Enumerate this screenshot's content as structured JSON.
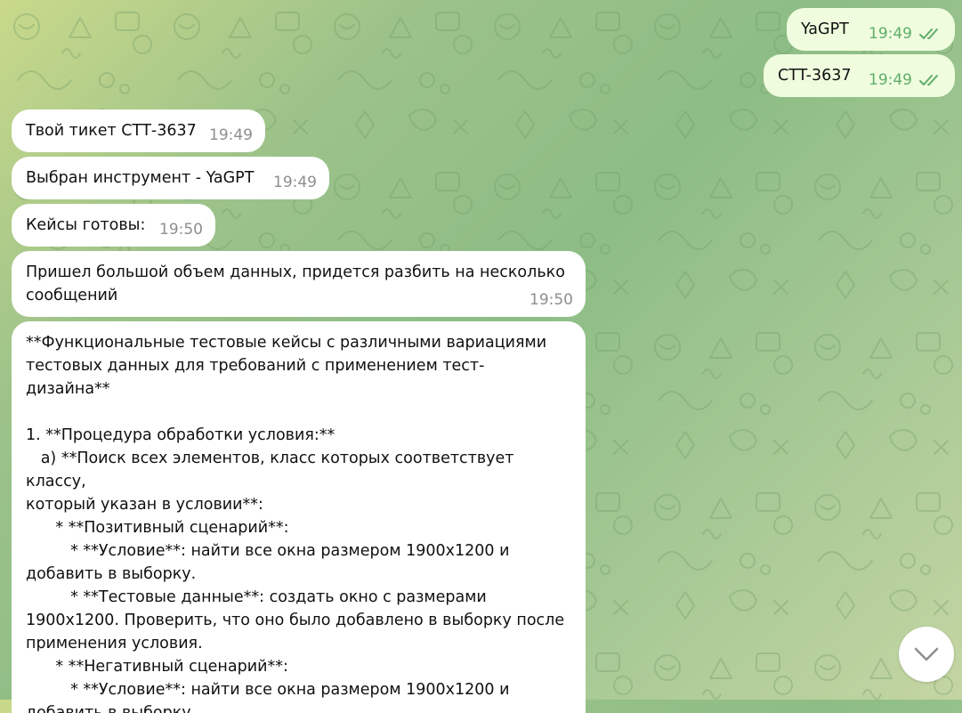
{
  "outgoing": [
    {
      "text": "YaGPT",
      "time": "19:49",
      "status_icon": "double-check-icon"
    },
    {
      "text": "CTT-3637",
      "time": "19:49",
      "status_icon": "double-check-icon"
    }
  ],
  "incoming": [
    {
      "text": "Твой тикет СТТ-3637",
      "time": "19:49"
    },
    {
      "text": "Выбран инструмент - YaGPT",
      "time": "19:49"
    },
    {
      "text": "Кейсы готовы:",
      "time": "19:50"
    },
    {
      "text": "Пришел большой объем данных, придется разбить на несколько\nсообщений",
      "time": "19:50"
    },
    {
      "text": "**Функциональные тестовые кейсы с различными вариациями\nтестовых данных для требований с применением тест-\nдизайна**\n\n1. **Процедура обработки условия:**\n   a) **Поиск всех элементов, класс которых соответствует классу,\nкоторый указан в условии**:\n      * **Позитивный сценарий**:\n         * **Условие**: найти все окна размером 1900x1200 и\nдобавить в выборку.\n         * **Тестовые данные**: создать окно с размерами\n1900x1200. Проверить, что оно было добавлено в выборку после\nприменения условия.\n      * **Негативный сценарий**:\n         * **Условие**: найти все окна размером 1900x1200 и\nдобавить в выборку."
    }
  ],
  "scroll_button": {
    "icon": "chevron-down-icon"
  },
  "colors": {
    "outgoing_bubble": "#effdde",
    "incoming_bubble": "#ffffff",
    "outgoing_time": "#5fad6a",
    "incoming_time": "#8e8e8e",
    "pattern": "#6e9a66"
  }
}
